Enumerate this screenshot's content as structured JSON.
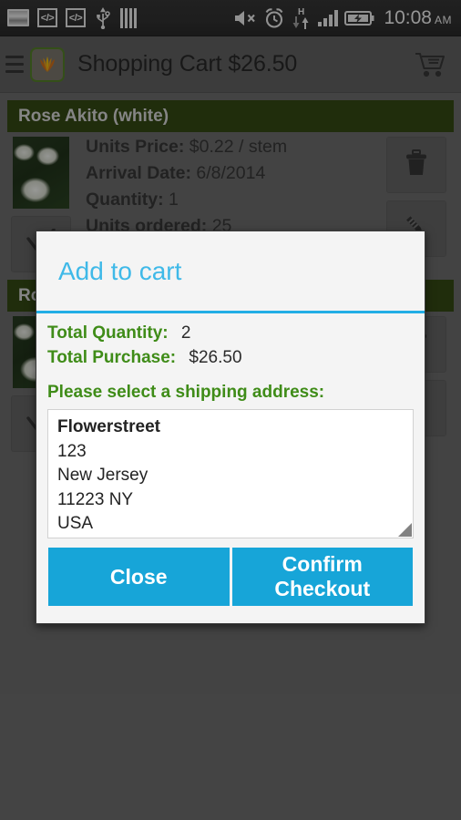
{
  "statusbar": {
    "left_icons": [
      "screenshot-icon",
      "code-icon",
      "code-icon-2",
      "usb-icon",
      "bars-icon"
    ],
    "right_icons": [
      "volume-mute-icon",
      "alarm-icon",
      "hspa-data-icon",
      "signal-icon",
      "battery-charging-icon"
    ],
    "time": "10:08",
    "ampm": "AM"
  },
  "appbar": {
    "menu_icon": "hamburger-menu-icon",
    "logo_icon": "tulip-logo-icon",
    "title": "Shopping Cart $26.50",
    "cart_icon": "shopping-cart-icon"
  },
  "cards": [
    {
      "title": "Rose Akito (white)",
      "thumbnail_icon": "white-rose-photo",
      "fields": [
        {
          "label": "Units Price:",
          "value": "$0.22 / stem"
        },
        {
          "label": "Arrival Date:",
          "value": "6/8/2014"
        },
        {
          "label": "Quantity:",
          "value": "1"
        },
        {
          "label": "Units ordered:",
          "value": "25"
        }
      ],
      "delete_icon": "trash-icon",
      "edit_icon": "pencil-icon",
      "confirm_icon": "check-icon"
    },
    {
      "title": "Rose Akito (white)",
      "thumbnail_icon": "white-rose-photo",
      "fields": [],
      "delete_icon": "trash-icon",
      "edit_icon": "pencil-icon",
      "confirm_icon": "check-icon"
    }
  ],
  "dialog": {
    "title": "Add to cart",
    "total_quantity_label": "Total Quantity:",
    "total_quantity_value": "2",
    "total_purchase_label": "Total Purchase:",
    "total_purchase_value": "$26.50",
    "address_prompt": "Please select a shipping address:",
    "address": {
      "street_name": "Flowerstreet",
      "number": "123",
      "city": "New Jersey",
      "zip_state": "11223   NY",
      "country": "USA"
    },
    "resize_handle_icon": "resize-grip-icon",
    "close_label": "Close",
    "confirm_label": "Confirm Checkout"
  },
  "colors": {
    "accent_blue": "#17a5d8",
    "title_blue": "#3fb9e8",
    "label_green": "#3f8c18",
    "card_header_green": "#2a4008",
    "background_gray": "#666666"
  }
}
